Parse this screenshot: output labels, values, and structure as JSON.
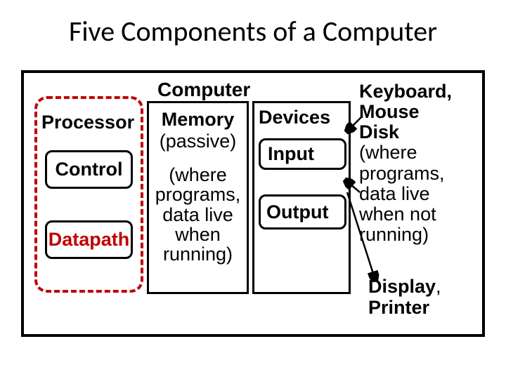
{
  "title": "Five Components of a Computer",
  "computer_label": "Computer",
  "processor": {
    "label": "Processor",
    "control": "Control",
    "datapath": "Datapath"
  },
  "memory": {
    "title": "Memory",
    "passive": "(passive)",
    "desc": "(where\nprograms,\ndata live\nwhen\nrunning)"
  },
  "devices": {
    "label": "Devices",
    "input": "Input",
    "output": "Output"
  },
  "right_text": {
    "line1": "Keyboard,",
    "line2": "Mouse",
    "line3": "Disk",
    "desc": "(where\nprograms,\ndata live\nwhen not\nrunning)"
  },
  "bottom_right": {
    "line1": "Display",
    "line2": "Printer"
  }
}
